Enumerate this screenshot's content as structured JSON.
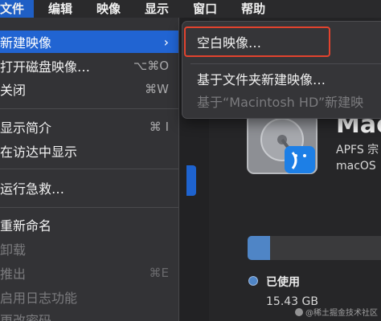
{
  "menubar": {
    "items": [
      "文件",
      "编辑",
      "映像",
      "显示",
      "窗口",
      "帮助"
    ]
  },
  "file_menu": {
    "items": [
      {
        "label": "新建映像",
        "shortcut": "",
        "state": "highlighted",
        "has_submenu": true
      },
      {
        "label": "打开磁盘映像…",
        "shortcut": "⌥⌘O",
        "state": "normal"
      },
      {
        "label": "关闭",
        "shortcut": "⌘W",
        "state": "normal"
      },
      {
        "label": "显示简介",
        "shortcut": "⌘ I",
        "state": "normal"
      },
      {
        "label": "在访达中显示",
        "shortcut": "",
        "state": "normal"
      },
      {
        "label": "运行急救…",
        "shortcut": "",
        "state": "normal"
      },
      {
        "label": "重新命名",
        "shortcut": "",
        "state": "normal"
      },
      {
        "label": "卸载",
        "shortcut": "",
        "state": "disabled"
      },
      {
        "label": "推出",
        "shortcut": "⌘E",
        "state": "disabled"
      },
      {
        "label": "启用日志功能",
        "shortcut": "",
        "state": "disabled"
      },
      {
        "label": "更改密码…",
        "shortcut": "",
        "state": "disabled"
      }
    ],
    "chevron": "›"
  },
  "submenu": {
    "items": [
      {
        "label": "空白映像…",
        "state": "normal",
        "highlighted_by_annotation": true
      },
      {
        "label": "基于文件夹新建映像…",
        "state": "normal"
      },
      {
        "label": "基于“Macintosh HD”新建映",
        "state": "disabled"
      }
    ]
  },
  "disk": {
    "title": "Mac",
    "sub1": "APFS 宗",
    "sub2": "macOS"
  },
  "usage": {
    "used_fraction": 0.17,
    "legend_label": "已使用",
    "legend_value": "15.43 GB"
  },
  "watermark": "@稀土掘金技术社区",
  "colors": {
    "highlight_blue": "#2164d2",
    "annotation_red": "#e2432e",
    "used_blue": "#4f85c6"
  }
}
